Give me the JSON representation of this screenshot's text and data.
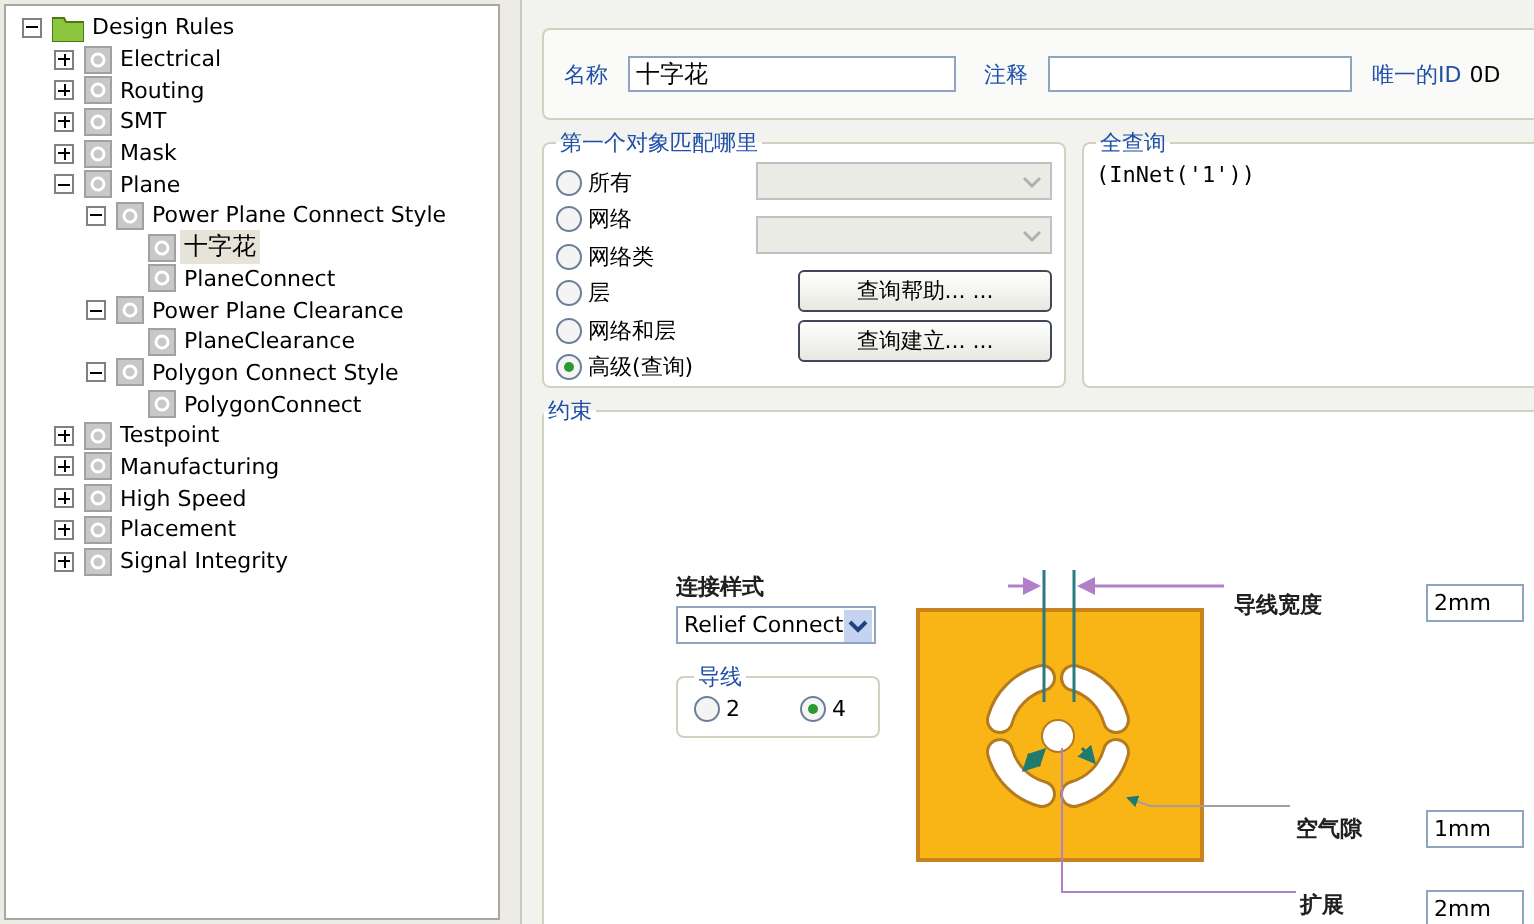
{
  "tree": {
    "label": "Design Rules",
    "expanded": true,
    "selected": false,
    "children": [
      {
        "label": "Electrical",
        "expanded": false,
        "selected": false
      },
      {
        "label": "Routing",
        "expanded": false,
        "selected": false
      },
      {
        "label": "SMT",
        "expanded": false,
        "selected": false
      },
      {
        "label": "Mask",
        "expanded": false,
        "selected": false
      },
      {
        "label": "Plane",
        "expanded": true,
        "selected": false,
        "children": [
          {
            "label": "Power Plane Connect Style",
            "expanded": true,
            "selected": false,
            "children": [
              {
                "label": "十字花",
                "selected": true
              },
              {
                "label": "PlaneConnect",
                "selected": false
              }
            ]
          },
          {
            "label": "Power Plane Clearance",
            "expanded": true,
            "selected": false,
            "children": [
              {
                "label": "PlaneClearance",
                "selected": false
              }
            ]
          },
          {
            "label": "Polygon Connect Style",
            "expanded": true,
            "selected": false,
            "children": [
              {
                "label": "PolygonConnect",
                "selected": false
              }
            ]
          }
        ]
      },
      {
        "label": "Testpoint",
        "expanded": false,
        "selected": false
      },
      {
        "label": "Manufacturing",
        "expanded": false,
        "selected": false
      },
      {
        "label": "High Speed",
        "expanded": false,
        "selected": false
      },
      {
        "label": "Placement",
        "expanded": false,
        "selected": false
      },
      {
        "label": "Signal Integrity",
        "expanded": false,
        "selected": false
      }
    ]
  },
  "name_row": {
    "name_label": "名称",
    "name_value": "十字花",
    "comment_label": "注释",
    "id_label": "唯一的ID",
    "id_value": "0D"
  },
  "match": {
    "title": "第一个对象匹配哪里",
    "options": [
      {
        "label": "所有",
        "selected": false
      },
      {
        "label": "网络",
        "selected": false
      },
      {
        "label": "网络类",
        "selected": false
      },
      {
        "label": "层",
        "selected": false
      },
      {
        "label": "网络和层",
        "selected": false
      },
      {
        "label": "高级(查询)",
        "selected": true
      }
    ],
    "dropdowns": [
      {
        "disabled": true
      },
      {
        "disabled": true
      }
    ],
    "buttons": [
      "查询帮助... ...",
      "查询建立... ..."
    ]
  },
  "query": {
    "title": "全查询",
    "text": "(InNet('1'))"
  },
  "constraints": {
    "title": "约束",
    "connect_style_label": "连接样式",
    "connect_style": "Relief Connect",
    "conductors": {
      "title": "导线",
      "options": [
        {
          "label": "2",
          "selected": false
        },
        {
          "label": "4",
          "selected": true
        }
      ]
    },
    "conductor_width": {
      "label": "导线宽度",
      "value": "2mm"
    },
    "air_gap": {
      "label": "空气隙",
      "value": "1mm"
    },
    "expansion": {
      "label": "扩展",
      "value": "2mm"
    }
  }
}
